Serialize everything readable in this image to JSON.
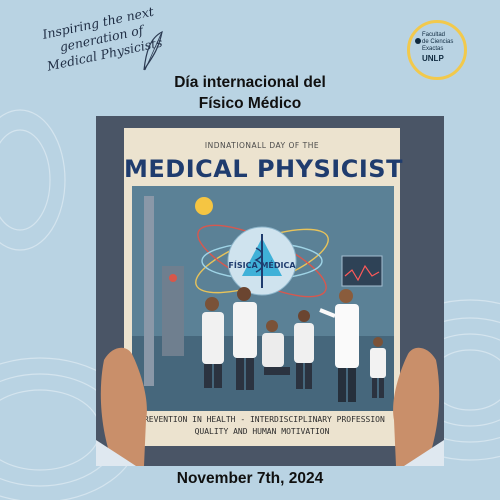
{
  "tagline": {
    "line1": "Inspiring the next",
    "line2": "generation of",
    "line3": "Medical Physicists"
  },
  "logo": {
    "line1": "Facultad",
    "line2": "de Ciencias",
    "line3": "Exactas",
    "line4": "UNLP",
    "ring_color": "#f2c94c"
  },
  "title": {
    "line1": "Día internacional del",
    "line2": "Físico Médico"
  },
  "poster": {
    "small_title": "INDNATIONALL DAY OF THE",
    "big_title": "MEDICAL PHYSICIST",
    "emblem_text": "FÍSICA MÉDICA",
    "footer_line1": "PREVENTION IN HEALTH - INTERDISCIPLINARY PROFESSION",
    "footer_line2": "QUALITY AND HUMAN MOTIVATION",
    "title_color": "#1f3c6e"
  },
  "date": "November 7th, 2024",
  "colors": {
    "background": "#b9d3e3",
    "text": "#101010"
  }
}
